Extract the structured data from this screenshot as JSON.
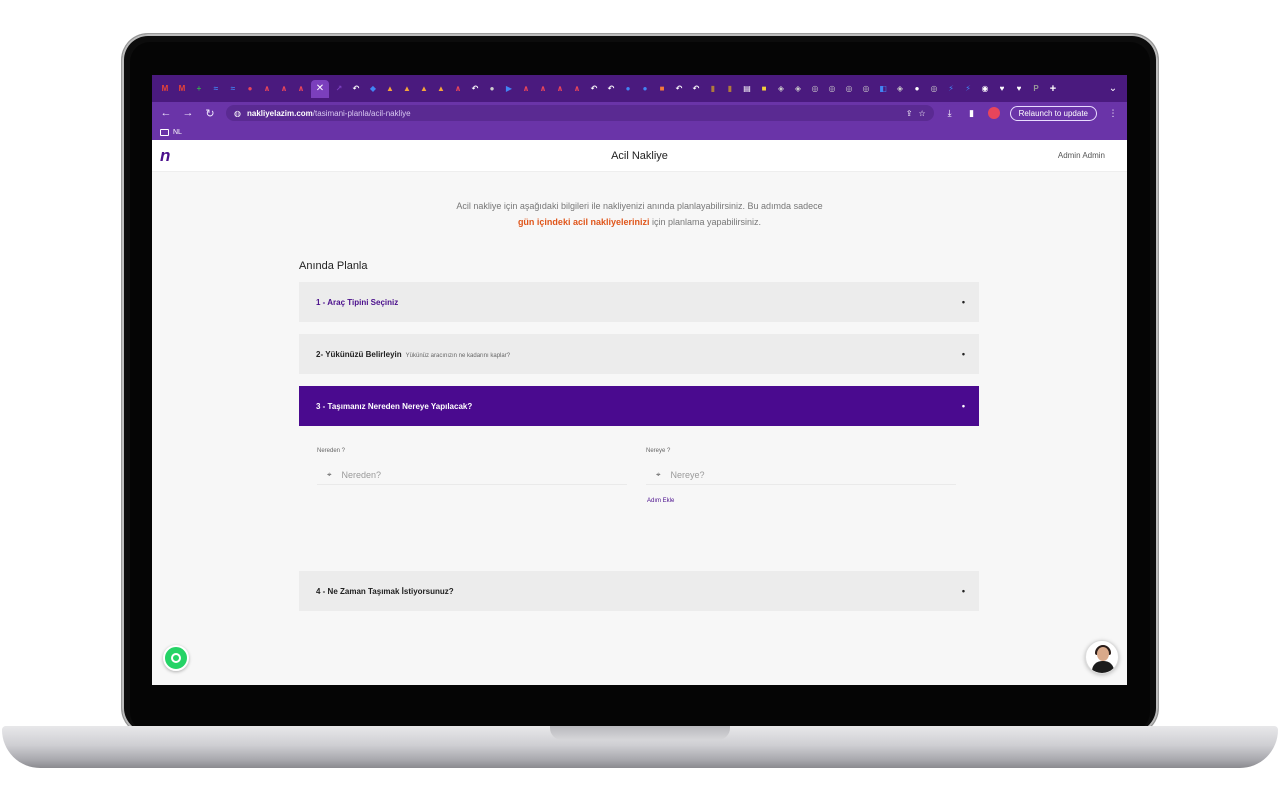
{
  "browser": {
    "url_host": "nakliyelazim.com",
    "url_path": "/tasimani-planla/acil-nakliye",
    "relaunch_label": "Relaunch to update",
    "bookmark_folder": "NL",
    "tabs": [
      {
        "icon": "gmail-icon",
        "color": "#ea4335",
        "glyph": "M"
      },
      {
        "icon": "gmail-icon",
        "color": "#ea4335",
        "glyph": "M"
      },
      {
        "icon": "plus-app-icon",
        "color": "#34a853",
        "glyph": "+"
      },
      {
        "icon": "app-icon",
        "color": "#4285f4",
        "glyph": "≈"
      },
      {
        "icon": "app-icon",
        "color": "#4285f4",
        "glyph": "≈"
      },
      {
        "icon": "app-icon",
        "color": "#e8455b",
        "glyph": "●"
      },
      {
        "icon": "app-icon",
        "color": "#e8455b",
        "glyph": "∧"
      },
      {
        "icon": "app-icon",
        "color": "#e8455b",
        "glyph": "∧"
      },
      {
        "icon": "app-icon",
        "color": "#e8455b",
        "glyph": "∧"
      }
    ],
    "tabs_after": [
      {
        "icon": "app-icon",
        "color": "#7b3fbd",
        "glyph": "↗"
      },
      {
        "icon": "app-icon",
        "color": "#ffffff",
        "glyph": "↶"
      },
      {
        "icon": "app-icon",
        "color": "#4285f4",
        "glyph": "◆"
      },
      {
        "icon": "app-icon",
        "color": "#f4a53b",
        "glyph": "▲"
      },
      {
        "icon": "app-icon",
        "color": "#f4a53b",
        "glyph": "▲"
      },
      {
        "icon": "app-icon",
        "color": "#f4a53b",
        "glyph": "▲"
      },
      {
        "icon": "app-icon",
        "color": "#f4a53b",
        "glyph": "▲"
      },
      {
        "icon": "app-icon",
        "color": "#e8455b",
        "glyph": "∧"
      },
      {
        "icon": "app-icon",
        "color": "#ffffff",
        "glyph": "↶"
      },
      {
        "icon": "app-icon",
        "color": "#cccccc",
        "glyph": "●"
      },
      {
        "icon": "app-icon",
        "color": "#4285f4",
        "glyph": "▶"
      },
      {
        "icon": "app-icon",
        "color": "#e8455b",
        "glyph": "∧"
      },
      {
        "icon": "app-icon",
        "color": "#e8455b",
        "glyph": "∧"
      },
      {
        "icon": "app-icon",
        "color": "#e8455b",
        "glyph": "∧"
      },
      {
        "icon": "app-icon",
        "color": "#e8455b",
        "glyph": "∧"
      },
      {
        "icon": "app-icon",
        "color": "#ffffff",
        "glyph": "↶"
      },
      {
        "icon": "app-icon",
        "color": "#ffffff",
        "glyph": "↶"
      },
      {
        "icon": "app-icon",
        "color": "#4285f4",
        "glyph": "●"
      },
      {
        "icon": "app-icon",
        "color": "#4285f4",
        "glyph": "●"
      },
      {
        "icon": "app-icon",
        "color": "#f4793b",
        "glyph": "■"
      },
      {
        "icon": "app-icon",
        "color": "#ffffff",
        "glyph": "↶"
      },
      {
        "icon": "app-icon",
        "color": "#ffffff",
        "glyph": "↶"
      },
      {
        "icon": "app-icon",
        "color": "#b07b3b",
        "glyph": "▮"
      },
      {
        "icon": "app-icon",
        "color": "#b07b3b",
        "glyph": "▮"
      },
      {
        "icon": "app-icon",
        "color": "#ffffff",
        "glyph": "▤"
      },
      {
        "icon": "app-icon",
        "color": "#f4d03b",
        "glyph": "■"
      },
      {
        "icon": "app-icon",
        "color": "#cccccc",
        "glyph": "◈"
      },
      {
        "icon": "app-icon",
        "color": "#cccccc",
        "glyph": "◈"
      },
      {
        "icon": "app-icon",
        "color": "#cccccc",
        "glyph": "◎"
      },
      {
        "icon": "app-icon",
        "color": "#cccccc",
        "glyph": "◎"
      },
      {
        "icon": "app-icon",
        "color": "#cccccc",
        "glyph": "◎"
      },
      {
        "icon": "app-icon",
        "color": "#cccccc",
        "glyph": "◎"
      },
      {
        "icon": "app-icon",
        "color": "#4285f4",
        "glyph": "◧"
      },
      {
        "icon": "app-icon",
        "color": "#cccccc",
        "glyph": "◈"
      },
      {
        "icon": "app-icon",
        "color": "#ffffff",
        "glyph": "●"
      },
      {
        "icon": "app-icon",
        "color": "#cccccc",
        "glyph": "◎"
      },
      {
        "icon": "app-icon",
        "color": "#4285f4",
        "glyph": "⚡"
      },
      {
        "icon": "app-icon",
        "color": "#4285f4",
        "glyph": "⚡"
      },
      {
        "icon": "app-icon",
        "color": "#ffffff",
        "glyph": "◉"
      },
      {
        "icon": "app-icon",
        "color": "#ffffff",
        "glyph": "♥"
      },
      {
        "icon": "app-icon",
        "color": "#ffffff",
        "glyph": "♥"
      },
      {
        "icon": "app-icon",
        "color": "#999999",
        "glyph": "P"
      }
    ]
  },
  "app": {
    "logo": "n",
    "title": "Acil Nakliye",
    "user": "Admin Admin"
  },
  "intro": {
    "line1": "Acil nakliye için aşağıdaki bilgileri ile nakliyenizi anında planlayabilirsiniz. Bu adımda sadece",
    "highlight": "gün içindeki acil nakliyelerinizi",
    "line2_rest": " için planlama yapabilirsiniz."
  },
  "section_title": "Anında Planla",
  "steps": [
    {
      "label": "1 - Araç Tipini Seçiniz",
      "sub": ""
    },
    {
      "label": "2- Yükünüzü Belirleyin",
      "sub": "Yükünüz aracınızın ne kadarını kaplar?"
    },
    {
      "label": "3 - Taşımanız Nereden Nereye Yapılacak?",
      "sub": ""
    },
    {
      "label": "4 - Ne Zaman Taşımak İstiyorsunuz?",
      "sub": ""
    }
  ],
  "route": {
    "from_label": "Nereden ?",
    "from_placeholder": "Nereden?",
    "to_label": "Nereye ?",
    "to_placeholder": "Nereye?",
    "add_stop": "Adım Ekle"
  },
  "colors": {
    "brand_purple": "#4a0a8f",
    "accent_orange": "#e0561b",
    "whatsapp_green": "#25d366"
  }
}
